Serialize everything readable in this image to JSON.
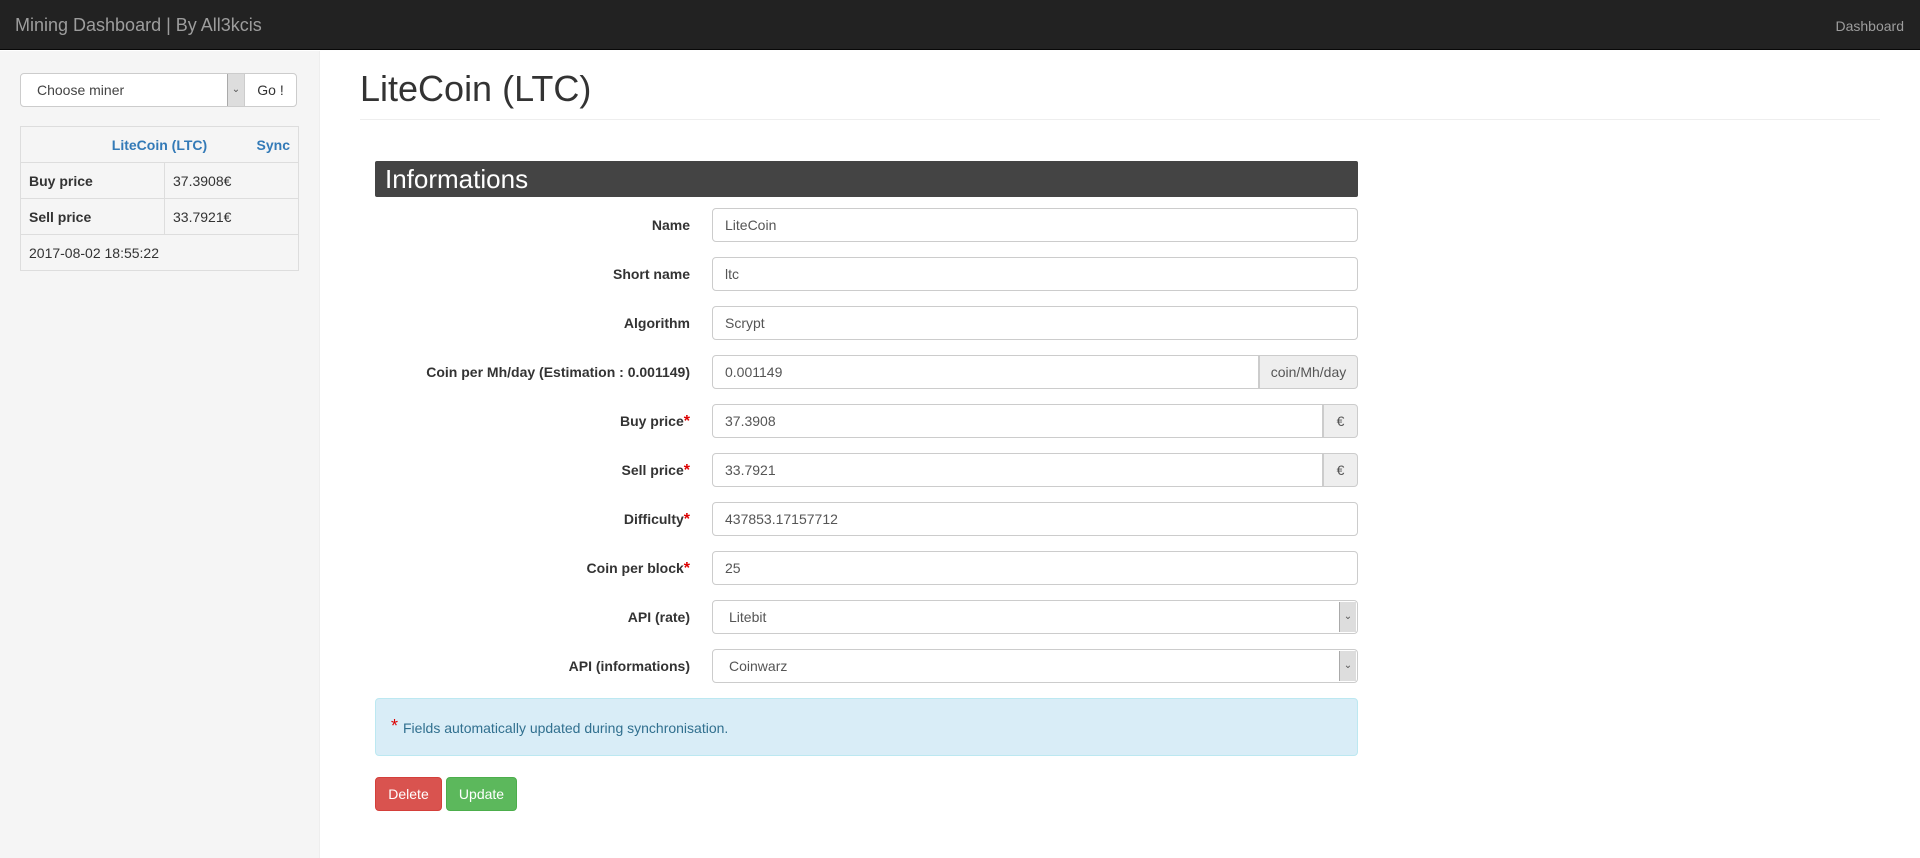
{
  "navbar": {
    "brand": "Mining Dashboard | By All3kcis",
    "right_link": "Dashboard"
  },
  "sidebar": {
    "miner_select": {
      "value": "Choose miner",
      "go_label": "Go !"
    },
    "coin_table": {
      "coin_link": "LiteCoin (LTC)",
      "sync_link": "Sync",
      "rows": [
        {
          "label": "Buy price",
          "value": "37.3908€"
        },
        {
          "label": "Sell price",
          "value": "33.7921€"
        }
      ],
      "timestamp": "2017-08-02 18:55:22"
    }
  },
  "main": {
    "title": "LiteCoin (LTC)",
    "section_title": "Informations",
    "fields": {
      "name": {
        "label": "Name",
        "value": "LiteCoin"
      },
      "short_name": {
        "label": "Short name",
        "value": "ltc"
      },
      "algorithm": {
        "label": "Algorithm",
        "value": "Scrypt"
      },
      "coin_per_mh": {
        "label": "Coin per Mh/day (Estimation : 0.001149)",
        "value": "0.001149",
        "addon": "coin/Mh/day"
      },
      "buy_price": {
        "label": "Buy price",
        "value": "37.3908",
        "addon": "€"
      },
      "sell_price": {
        "label": "Sell price",
        "value": "33.7921",
        "addon": "€"
      },
      "difficulty": {
        "label": "Difficulty",
        "value": "437853.17157712"
      },
      "coin_per_block": {
        "label": "Coin per block",
        "value": "25"
      },
      "api_rate": {
        "label": "API (rate)",
        "value": "Litebit"
      },
      "api_info": {
        "label": "API (informations)",
        "value": "Coinwarz"
      }
    },
    "required_mark": "*",
    "alert_text": "Fields automatically updated during synchronisation.",
    "buttons": {
      "delete": "Delete",
      "update": "Update"
    }
  }
}
